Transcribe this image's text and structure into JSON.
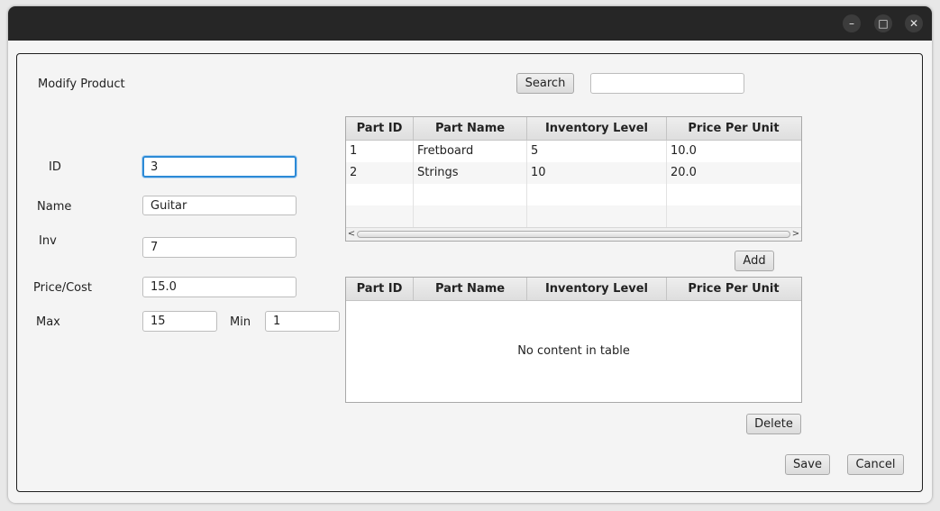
{
  "window": {
    "controls": {
      "minimize": "–",
      "maximize": "□",
      "close": "✕"
    }
  },
  "form": {
    "title": "Modify Product",
    "id_label": "ID",
    "id_value": "3",
    "name_label": "Name",
    "name_value": "Guitar",
    "inv_label": "Inv",
    "inv_value": "7",
    "price_label": "Price/Cost",
    "price_value": "15.0",
    "max_label": "Max",
    "max_value": "15",
    "min_label": "Min",
    "min_value": "1"
  },
  "search": {
    "button_label": "Search",
    "value": ""
  },
  "parts_table": {
    "columns": [
      "Part ID",
      "Part Name",
      "Inventory Level",
      "Price Per Unit"
    ],
    "rows": [
      [
        "1",
        "Fretboard",
        "5",
        "10.0"
      ],
      [
        "2",
        "Strings",
        "10",
        "20.0"
      ]
    ]
  },
  "add_button_label": "Add",
  "associated_table": {
    "columns": [
      "Part ID",
      "Part Name",
      "Inventory Level",
      "Price Per Unit"
    ],
    "empty_message": "No content in table"
  },
  "delete_button_label": "Delete",
  "save_button_label": "Save",
  "cancel_button_label": "Cancel"
}
